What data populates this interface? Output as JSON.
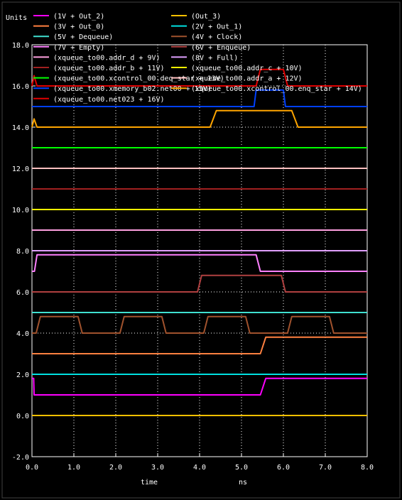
{
  "chart_data": {
    "type": "line",
    "ylabel_unit": "Units",
    "xlabel": "time",
    "xunit": "ns",
    "xlim": [
      0.0,
      8.0
    ],
    "ylim": [
      -2.0,
      18.0
    ],
    "x_ticks": [
      "0.0",
      "1.0",
      "2.0",
      "3.0",
      "4.0",
      "5.0",
      "6.0",
      "7.0",
      "8.0"
    ],
    "y_ticks": [
      "-2.0",
      "0.0",
      "2.0",
      "4.0",
      "6.0",
      "8.0",
      "10.0",
      "12.0",
      "14.0",
      "16.0",
      "18.0"
    ],
    "grid": true,
    "legend_position": "top",
    "series": [
      {
        "name": "(1V + Out_2)",
        "color": "#ff00ff",
        "points": [
          [
            0.0,
            1.8
          ],
          [
            0.04,
            1.8
          ],
          [
            0.05,
            1.0
          ],
          [
            5.45,
            1.0
          ],
          [
            5.58,
            1.8
          ],
          [
            8.0,
            1.8
          ]
        ]
      },
      {
        "name": "(Out_3)",
        "color": "#ffc000",
        "points": [
          [
            0.0,
            0.0
          ],
          [
            8.0,
            0.0
          ]
        ]
      },
      {
        "name": "(3V + Out_0)",
        "color": "#ff8040",
        "points": [
          [
            0.0,
            3.0
          ],
          [
            5.45,
            3.0
          ],
          [
            5.58,
            3.8
          ],
          [
            8.0,
            3.8
          ]
        ]
      },
      {
        "name": "(2V + Out_1)",
        "color": "#00e0e0",
        "points": [
          [
            0.0,
            2.0
          ],
          [
            8.0,
            2.0
          ]
        ]
      },
      {
        "name": "(5V + Dequeue)",
        "color": "#40e0d0",
        "points": [
          [
            0.0,
            5.0
          ],
          [
            8.0,
            5.0
          ]
        ]
      },
      {
        "name": "(4V + Clock)",
        "color": "#a0522d",
        "points": [
          [
            0.0,
            4.0
          ],
          [
            0.1,
            4.0
          ],
          [
            0.2,
            4.8
          ],
          [
            1.1,
            4.8
          ],
          [
            1.2,
            4.0
          ],
          [
            2.1,
            4.0
          ],
          [
            2.2,
            4.8
          ],
          [
            3.1,
            4.8
          ],
          [
            3.2,
            4.0
          ],
          [
            4.1,
            4.0
          ],
          [
            4.2,
            4.8
          ],
          [
            5.1,
            4.8
          ],
          [
            5.2,
            4.0
          ],
          [
            6.1,
            4.0
          ],
          [
            6.2,
            4.8
          ],
          [
            7.1,
            4.8
          ],
          [
            7.2,
            4.0
          ],
          [
            8.0,
            4.0
          ]
        ]
      },
      {
        "name": "(7V + Empty)",
        "color": "#ff80ff",
        "points": [
          [
            0.0,
            7.0
          ],
          [
            0.06,
            7.0
          ],
          [
            0.12,
            7.8
          ],
          [
            5.35,
            7.8
          ],
          [
            5.45,
            7.0
          ],
          [
            8.0,
            7.0
          ]
        ]
      },
      {
        "name": "(6V + Enqueue)",
        "color": "#b04040",
        "points": [
          [
            0.0,
            6.0
          ],
          [
            3.95,
            6.0
          ],
          [
            4.05,
            6.8
          ],
          [
            5.95,
            6.8
          ],
          [
            6.05,
            6.0
          ],
          [
            8.0,
            6.0
          ]
        ]
      },
      {
        "name": "(xqueue_to00.addr_d + 9V)",
        "color": "#ffa0e0",
        "points": [
          [
            0.0,
            9.0
          ],
          [
            8.0,
            9.0
          ]
        ]
      },
      {
        "name": "(8V + Full)",
        "color": "#e0a0ff",
        "points": [
          [
            0.0,
            8.0
          ],
          [
            8.0,
            8.0
          ]
        ]
      },
      {
        "name": "(xqueue_to00.addr_b + 11V)",
        "color": "#a02020",
        "points": [
          [
            0.0,
            11.0
          ],
          [
            8.0,
            11.0
          ]
        ]
      },
      {
        "name": "(xqueue_to00.addr_c + 10V)",
        "color": "#ffff00",
        "points": [
          [
            0.0,
            10.0
          ],
          [
            8.0,
            10.0
          ]
        ]
      },
      {
        "name": "(xqueue_to00.xcontrol_00.deq_star + 13V)",
        "color": "#00ff00",
        "points": [
          [
            0.0,
            13.0
          ],
          [
            8.0,
            13.0
          ]
        ]
      },
      {
        "name": "(xqueue_to00.addr_a + 12V)",
        "color": "#ffc0c0",
        "points": [
          [
            0.0,
            12.0
          ],
          [
            8.0,
            12.0
          ]
        ]
      },
      {
        "name": "(xqueue_to00.xmemory_b02.net00 + 15V)",
        "color": "#0040ff",
        "points": [
          [
            0.0,
            15.0
          ],
          [
            5.3,
            15.0
          ],
          [
            5.35,
            15.8
          ],
          [
            6.0,
            15.8
          ],
          [
            6.05,
            15.0
          ],
          [
            8.0,
            15.0
          ]
        ]
      },
      {
        "name": "(xqueue_to00.xcontrol_00.enq_star + 14V)",
        "color": "#ffa500",
        "points": [
          [
            0.0,
            14.0
          ],
          [
            0.05,
            14.4
          ],
          [
            0.12,
            14.0
          ],
          [
            4.25,
            14.0
          ],
          [
            4.4,
            14.8
          ],
          [
            6.2,
            14.8
          ],
          [
            6.35,
            14.0
          ],
          [
            8.0,
            14.0
          ]
        ]
      },
      {
        "name": "(xqueue_to00.net023 + 16V)",
        "color": "#e00000",
        "points": [
          [
            0.0,
            16.0
          ],
          [
            0.05,
            16.5
          ],
          [
            0.12,
            16.0
          ],
          [
            5.35,
            16.0
          ],
          [
            5.45,
            16.8
          ],
          [
            6.0,
            16.8
          ],
          [
            6.1,
            16.0
          ],
          [
            8.0,
            16.0
          ]
        ]
      }
    ]
  }
}
